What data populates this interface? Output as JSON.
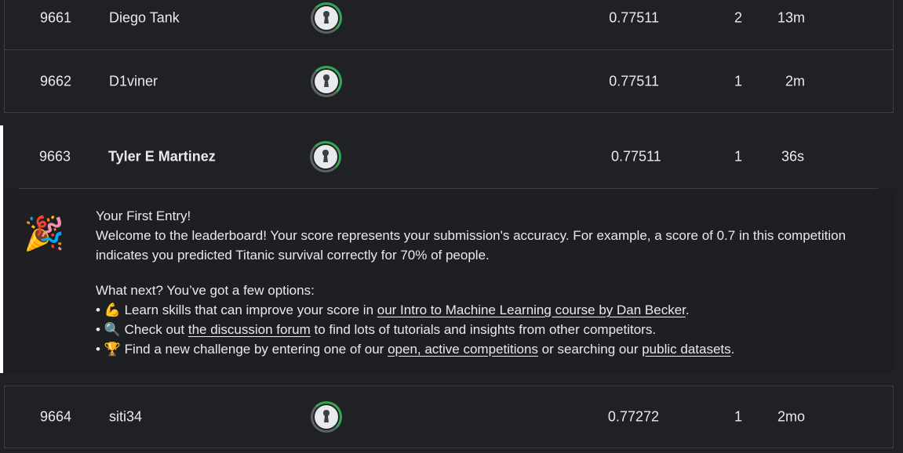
{
  "rows": [
    {
      "rank": "9661",
      "name": "Diego Tank",
      "score": "0.77511",
      "entries": "2",
      "last": "13m"
    },
    {
      "rank": "9662",
      "name": "D1viner",
      "score": "0.77511",
      "entries": "1",
      "last": "2m"
    },
    {
      "rank": "9663",
      "name": "Tyler E Martinez",
      "score": "0.77511",
      "entries": "1",
      "last": "36s"
    },
    {
      "rank": "9664",
      "name": "siti34",
      "score": "0.77272",
      "entries": "1",
      "last": "2mo"
    }
  ],
  "banner": {
    "icon": "🎉",
    "title": "Your First Entry!",
    "welcome": "Welcome to the leaderboard! Your score represents your submission's accuracy. For example, a score of 0.7 in this competition indicates you predicted Titanic survival correctly for 70% of people.",
    "next": "What next? You’ve got a few options:",
    "b1_pre": "• 💪 Learn skills that can improve your score in ",
    "b1_link": "our Intro to Machine Learning course by Dan Becker",
    "b1_post": ".",
    "b2_pre": "• 🔍 Check out ",
    "b2_link": "the discussion forum",
    "b2_post": " to find lots of tutorials and insights from other competitors.",
    "b3_pre": "• 🏆 Find a new challenge by entering one of our ",
    "b3_link": "open, active competitions",
    "b3_mid": " or searching our ",
    "b3_link2": "public datasets",
    "b3_post": "."
  }
}
